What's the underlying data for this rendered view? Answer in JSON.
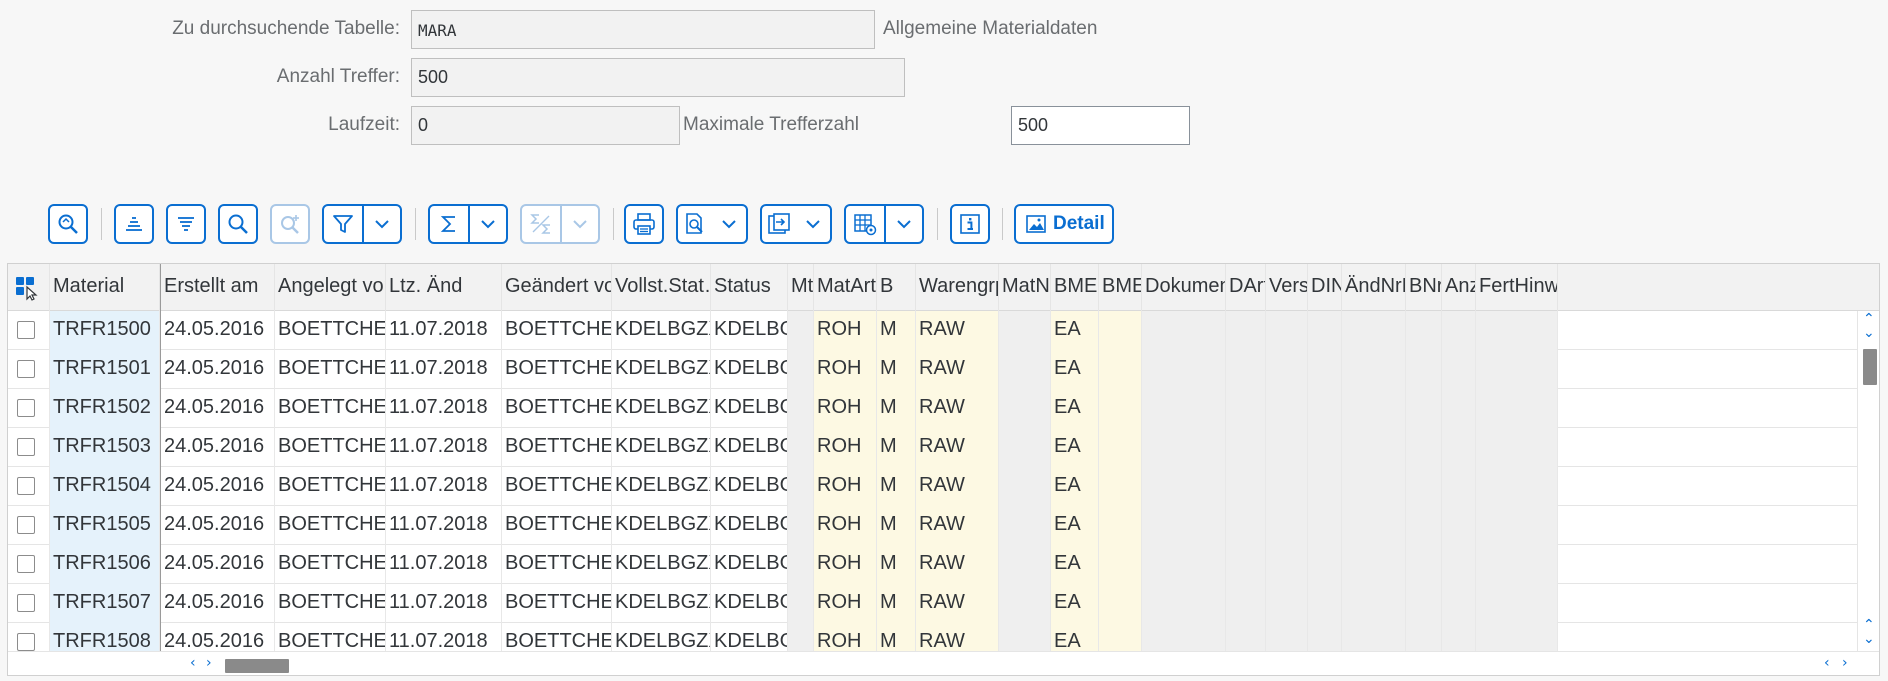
{
  "form": {
    "table_label": "Zu durchsuchende Tabelle:",
    "table_value": "MARA",
    "table_desc": "Allgemeine Materialdaten",
    "hits_label": "Anzahl Treffer:",
    "hits_value": "500",
    "runtime_label": "Laufzeit:",
    "runtime_value": "0",
    "maxhits_label": "Maximale Trefferzahl",
    "maxhits_value": "500"
  },
  "toolbar": {
    "detail_label": "Detail"
  },
  "columns": [
    "Material",
    "Erstellt am",
    "Angelegt von",
    "Ltz. Änd",
    "Geändert von",
    "Vollst.Stat…",
    "Status",
    "Mt",
    "MatArt",
    "B",
    "Warengrp",
    "MatNr",
    "BME",
    "BME",
    "Dokument",
    "DArt",
    "Vers",
    "DIN",
    "ÄndNrD",
    "BNr",
    "Anz",
    "FertHinw"
  ],
  "rows": [
    [
      "TRFR1500",
      "24.05.2016",
      "BOETTCHER",
      "11.07.2018",
      "BOETTCHER",
      "KDELBGZX",
      "KDELBG",
      "",
      "ROH",
      "M",
      "RAW",
      "",
      "EA",
      "",
      "",
      "",
      "",
      "",
      "",
      "",
      "",
      ""
    ],
    [
      "TRFR1501",
      "24.05.2016",
      "BOETTCHER",
      "11.07.2018",
      "BOETTCHER",
      "KDELBGZX",
      "KDELBG",
      "",
      "ROH",
      "M",
      "RAW",
      "",
      "EA",
      "",
      "",
      "",
      "",
      "",
      "",
      "",
      "",
      ""
    ],
    [
      "TRFR1502",
      "24.05.2016",
      "BOETTCHER",
      "11.07.2018",
      "BOETTCHER",
      "KDELBGZX",
      "KDELBG",
      "",
      "ROH",
      "M",
      "RAW",
      "",
      "EA",
      "",
      "",
      "",
      "",
      "",
      "",
      "",
      "",
      ""
    ],
    [
      "TRFR1503",
      "24.05.2016",
      "BOETTCHER",
      "11.07.2018",
      "BOETTCHER",
      "KDELBGZX",
      "KDELBG",
      "",
      "ROH",
      "M",
      "RAW",
      "",
      "EA",
      "",
      "",
      "",
      "",
      "",
      "",
      "",
      "",
      ""
    ],
    [
      "TRFR1504",
      "24.05.2016",
      "BOETTCHER",
      "11.07.2018",
      "BOETTCHER",
      "KDELBGZX",
      "KDELBG",
      "",
      "ROH",
      "M",
      "RAW",
      "",
      "EA",
      "",
      "",
      "",
      "",
      "",
      "",
      "",
      "",
      ""
    ],
    [
      "TRFR1505",
      "24.05.2016",
      "BOETTCHER",
      "11.07.2018",
      "BOETTCHER",
      "KDELBGZX",
      "KDELBG",
      "",
      "ROH",
      "M",
      "RAW",
      "",
      "EA",
      "",
      "",
      "",
      "",
      "",
      "",
      "",
      "",
      ""
    ],
    [
      "TRFR1506",
      "24.05.2016",
      "BOETTCHER",
      "11.07.2018",
      "BOETTCHER",
      "KDELBGZX",
      "KDELBG",
      "",
      "ROH",
      "M",
      "RAW",
      "",
      "EA",
      "",
      "",
      "",
      "",
      "",
      "",
      "",
      "",
      ""
    ],
    [
      "TRFR1507",
      "24.05.2016",
      "BOETTCHER",
      "11.07.2018",
      "BOETTCHER",
      "KDELBGZX",
      "KDELBG",
      "",
      "ROH",
      "M",
      "RAW",
      "",
      "EA",
      "",
      "",
      "",
      "",
      "",
      "",
      "",
      "",
      ""
    ],
    [
      "TRFR1508",
      "24.05.2016",
      "BOETTCHER",
      "11.07.2018",
      "BOETTCHER",
      "KDELBGZX",
      "KDELBG",
      "",
      "ROH",
      "M",
      "RAW",
      "",
      "EA",
      "",
      "",
      "",
      "",
      "",
      "",
      "",
      "",
      ""
    ]
  ],
  "colors": {
    "accent": "#0a6ed1",
    "key_column_bg": "#e5f2fb",
    "highlight_column_bg": "#fdf9e3"
  }
}
